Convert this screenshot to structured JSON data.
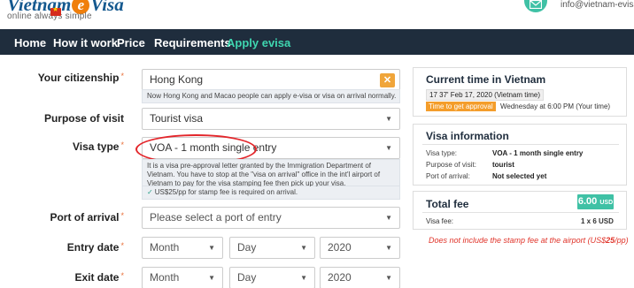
{
  "brand": {
    "name_a": "Vietnam",
    "name_e": "e",
    "name_b": "Visa",
    "tagline": "online always simple",
    "email": "info@vietnam-evisa.com"
  },
  "nav": {
    "items": [
      "Home",
      "How it work",
      "Price",
      "Requirements",
      "Apply evisa"
    ]
  },
  "form": {
    "citizenship_label": "Your citizenship",
    "citizenship_value": "Hong Kong",
    "citizenship_clear": "✕",
    "citizenship_note": "Now Hong Kong and Macao people can apply e-visa or visa on arrival normally.",
    "purpose_label": "Purpose of visit",
    "purpose_value": "Tourist visa",
    "visa_type_label": "Visa type",
    "visa_type_value": "VOA - 1 month single entry",
    "visa_type_note": "It is a visa pre-approval letter granted by the Immigration Department of Vietnam. You have to stop at the \"visa on arrival\" office in the int'l airport of Vietnam to pay for the visa stamping fee then pick up your visa.",
    "stamp_note": "US$25/pp for stamp fee is required on arrival.",
    "port_label": "Port of arrival",
    "port_placeholder": "Please select a port of entry",
    "entry_label": "Entry date",
    "exit_label": "Exit date",
    "month": "Month",
    "day": "Day",
    "year": "2020",
    "required_mark": "*"
  },
  "time_panel": {
    "title": "Current time in Vietnam",
    "time": "17 37'",
    "date": "Feb 17, 2020 (Vietnam time)",
    "approval_badge": "Time to get approval",
    "approval_time": "Wednesday at 6:00 PM (Your time)"
  },
  "visa_info": {
    "title": "Visa information",
    "rows": [
      {
        "k": "Visa type:",
        "v": "VOA - 1 month single entry"
      },
      {
        "k": "Purpose of visit:",
        "v": "tourist"
      },
      {
        "k": "Port of arrival:",
        "v": "Not selected yet"
      }
    ]
  },
  "fee": {
    "title": "Total fee",
    "amount": "6.00",
    "currency": "USD",
    "row_label": "Visa fee:",
    "row_value": "1 x 6 USD",
    "stamp_note_a": "Does not include the stamp fee at the airport (US$",
    "stamp_amount": "25",
    "stamp_note_b": "/pp)"
  },
  "colors": {
    "nav_bg": "#1f2d3d",
    "accent": "#3fd6b0",
    "orange": "#f49d2b",
    "circle": "#e3262b"
  }
}
